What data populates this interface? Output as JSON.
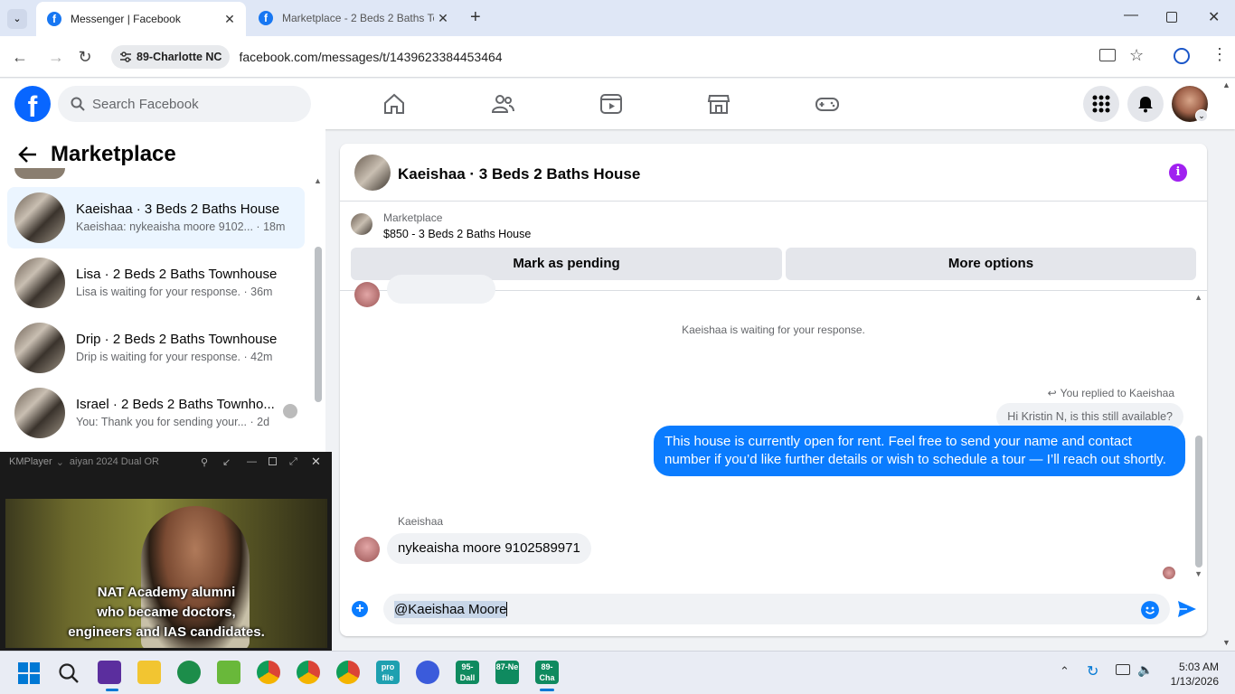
{
  "browser": {
    "tabs": [
      {
        "title": "Messenger | Facebook",
        "active": true
      },
      {
        "title": "Marketplace - 2 Beds 2 Baths To",
        "active": false
      }
    ],
    "site_chip": "89-Charlotte NC",
    "url": "facebook.com/messages/t/1439623384453464"
  },
  "fb": {
    "search_placeholder": "Search Facebook"
  },
  "left": {
    "title": "Marketplace",
    "conversations": [
      {
        "name": "Kaeishaa · 3 Beds 2 Baths House",
        "preview": "Kaeishaa: nykeaisha moore 9102... · 18m",
        "selected": true
      },
      {
        "name": "Lisa · 2 Beds 2 Baths Townhouse",
        "preview": "Lisa is waiting for your response. · 36m"
      },
      {
        "name": "Drip · 2 Beds 2 Baths Townhouse",
        "preview": "Drip is waiting for your response. · 42m"
      },
      {
        "name": "Israel · 2 Beds 2 Baths Townho...",
        "preview": "You: Thank you for sending your... · 2d"
      }
    ]
  },
  "kmplayer": {
    "app_name": "KMPlayer",
    "file_title": "aiyan 2024 Dual OR",
    "subtitle_lines": [
      "NAT Academy alumni",
      "who became doctors,",
      "engineers and IAS candidates."
    ]
  },
  "chat": {
    "title": "Kaeishaa · 3 Beds 2 Baths House",
    "marketplace_label": "Marketplace",
    "listing": "$850 - 3 Beds 2 Baths House",
    "mark_pending": "Mark as pending",
    "more_options": "More options",
    "waiting_notice": "Kaeishaa is waiting for your response.",
    "reply_note": "You replied to Kaeishaa",
    "quoted_message": "Hi Kristin N, is this still available?",
    "my_message": "This house is currently open for rent. Feel free to send your name and contact number if you’d like further details or wish to schedule a tour — I’ll reach out shortly.",
    "sender_name": "Kaeishaa",
    "their_message": "nykeaisha moore 9102589971",
    "input_value": "@Kaeishaa Moore"
  },
  "taskbar": {
    "labels": {
      "a": "95-Dall",
      "b": "87-Ne",
      "c": "89-Cha",
      "d": "pro file"
    },
    "time": "5:03 AM",
    "date": "1/13/2026"
  },
  "colors": {
    "fb_blue": "#0866ff",
    "bubble_blue": "#0a7cff",
    "selected_bg": "#ebf5ff",
    "info_purple": "#a020f0"
  }
}
